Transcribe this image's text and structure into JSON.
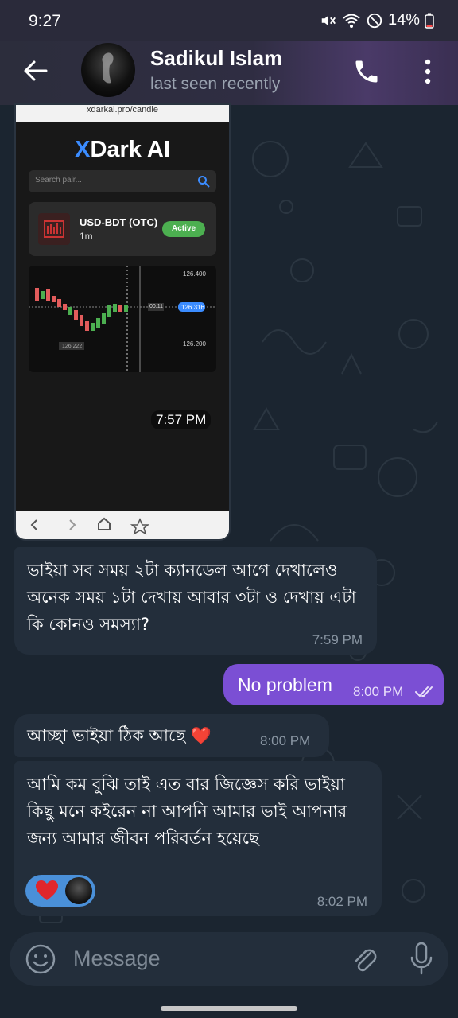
{
  "status_bar": {
    "time": "9:27",
    "battery": "14%"
  },
  "header": {
    "name": "Sadikul Islam",
    "status": "last seen recently"
  },
  "photo": {
    "url": "xdarkai.pro/candle",
    "logo_x": "X",
    "logo_rest": "Dark AI",
    "search_placeholder": "Search pair...",
    "pair_name": "USD-BDT (OTC)",
    "pair_timeframe": "1m",
    "active_label": "Active",
    "price_top": "126.400",
    "price_current": "126.316",
    "price_bottom": "126.200",
    "timer": "00:11",
    "price_low": "126.222",
    "time": "7:57 PM"
  },
  "messages": [
    {
      "text": "ভাইয়া সব সময় ২টা ক্যানডেল আগে দেখালেও অনেক সময় ১টা দেখায় আবার ৩টা ও দেখায় এটা কি কোনও সমস্যা?",
      "time": "7:59 PM"
    },
    {
      "text": "No problem",
      "time": "8:00 PM"
    },
    {
      "text": "আচ্ছা ভাইয়া ঠিক আছে ❤️",
      "time": "8:00 PM"
    },
    {
      "text": "আমি কম বুঝি তাই এত বার জিজ্ঞেস করি ভাইয়া কিছু মনে কইরেন না আপনি আমার ভাই আপনার জন্য আমার জীবন পরিবর্তন হয়েছে",
      "time": "8:02 PM"
    }
  ],
  "input": {
    "placeholder": "Message"
  },
  "colors": {
    "accent": "#7b4fd4",
    "bubble": "#232e3b",
    "background": "#1b2530",
    "active": "#4caf50"
  }
}
